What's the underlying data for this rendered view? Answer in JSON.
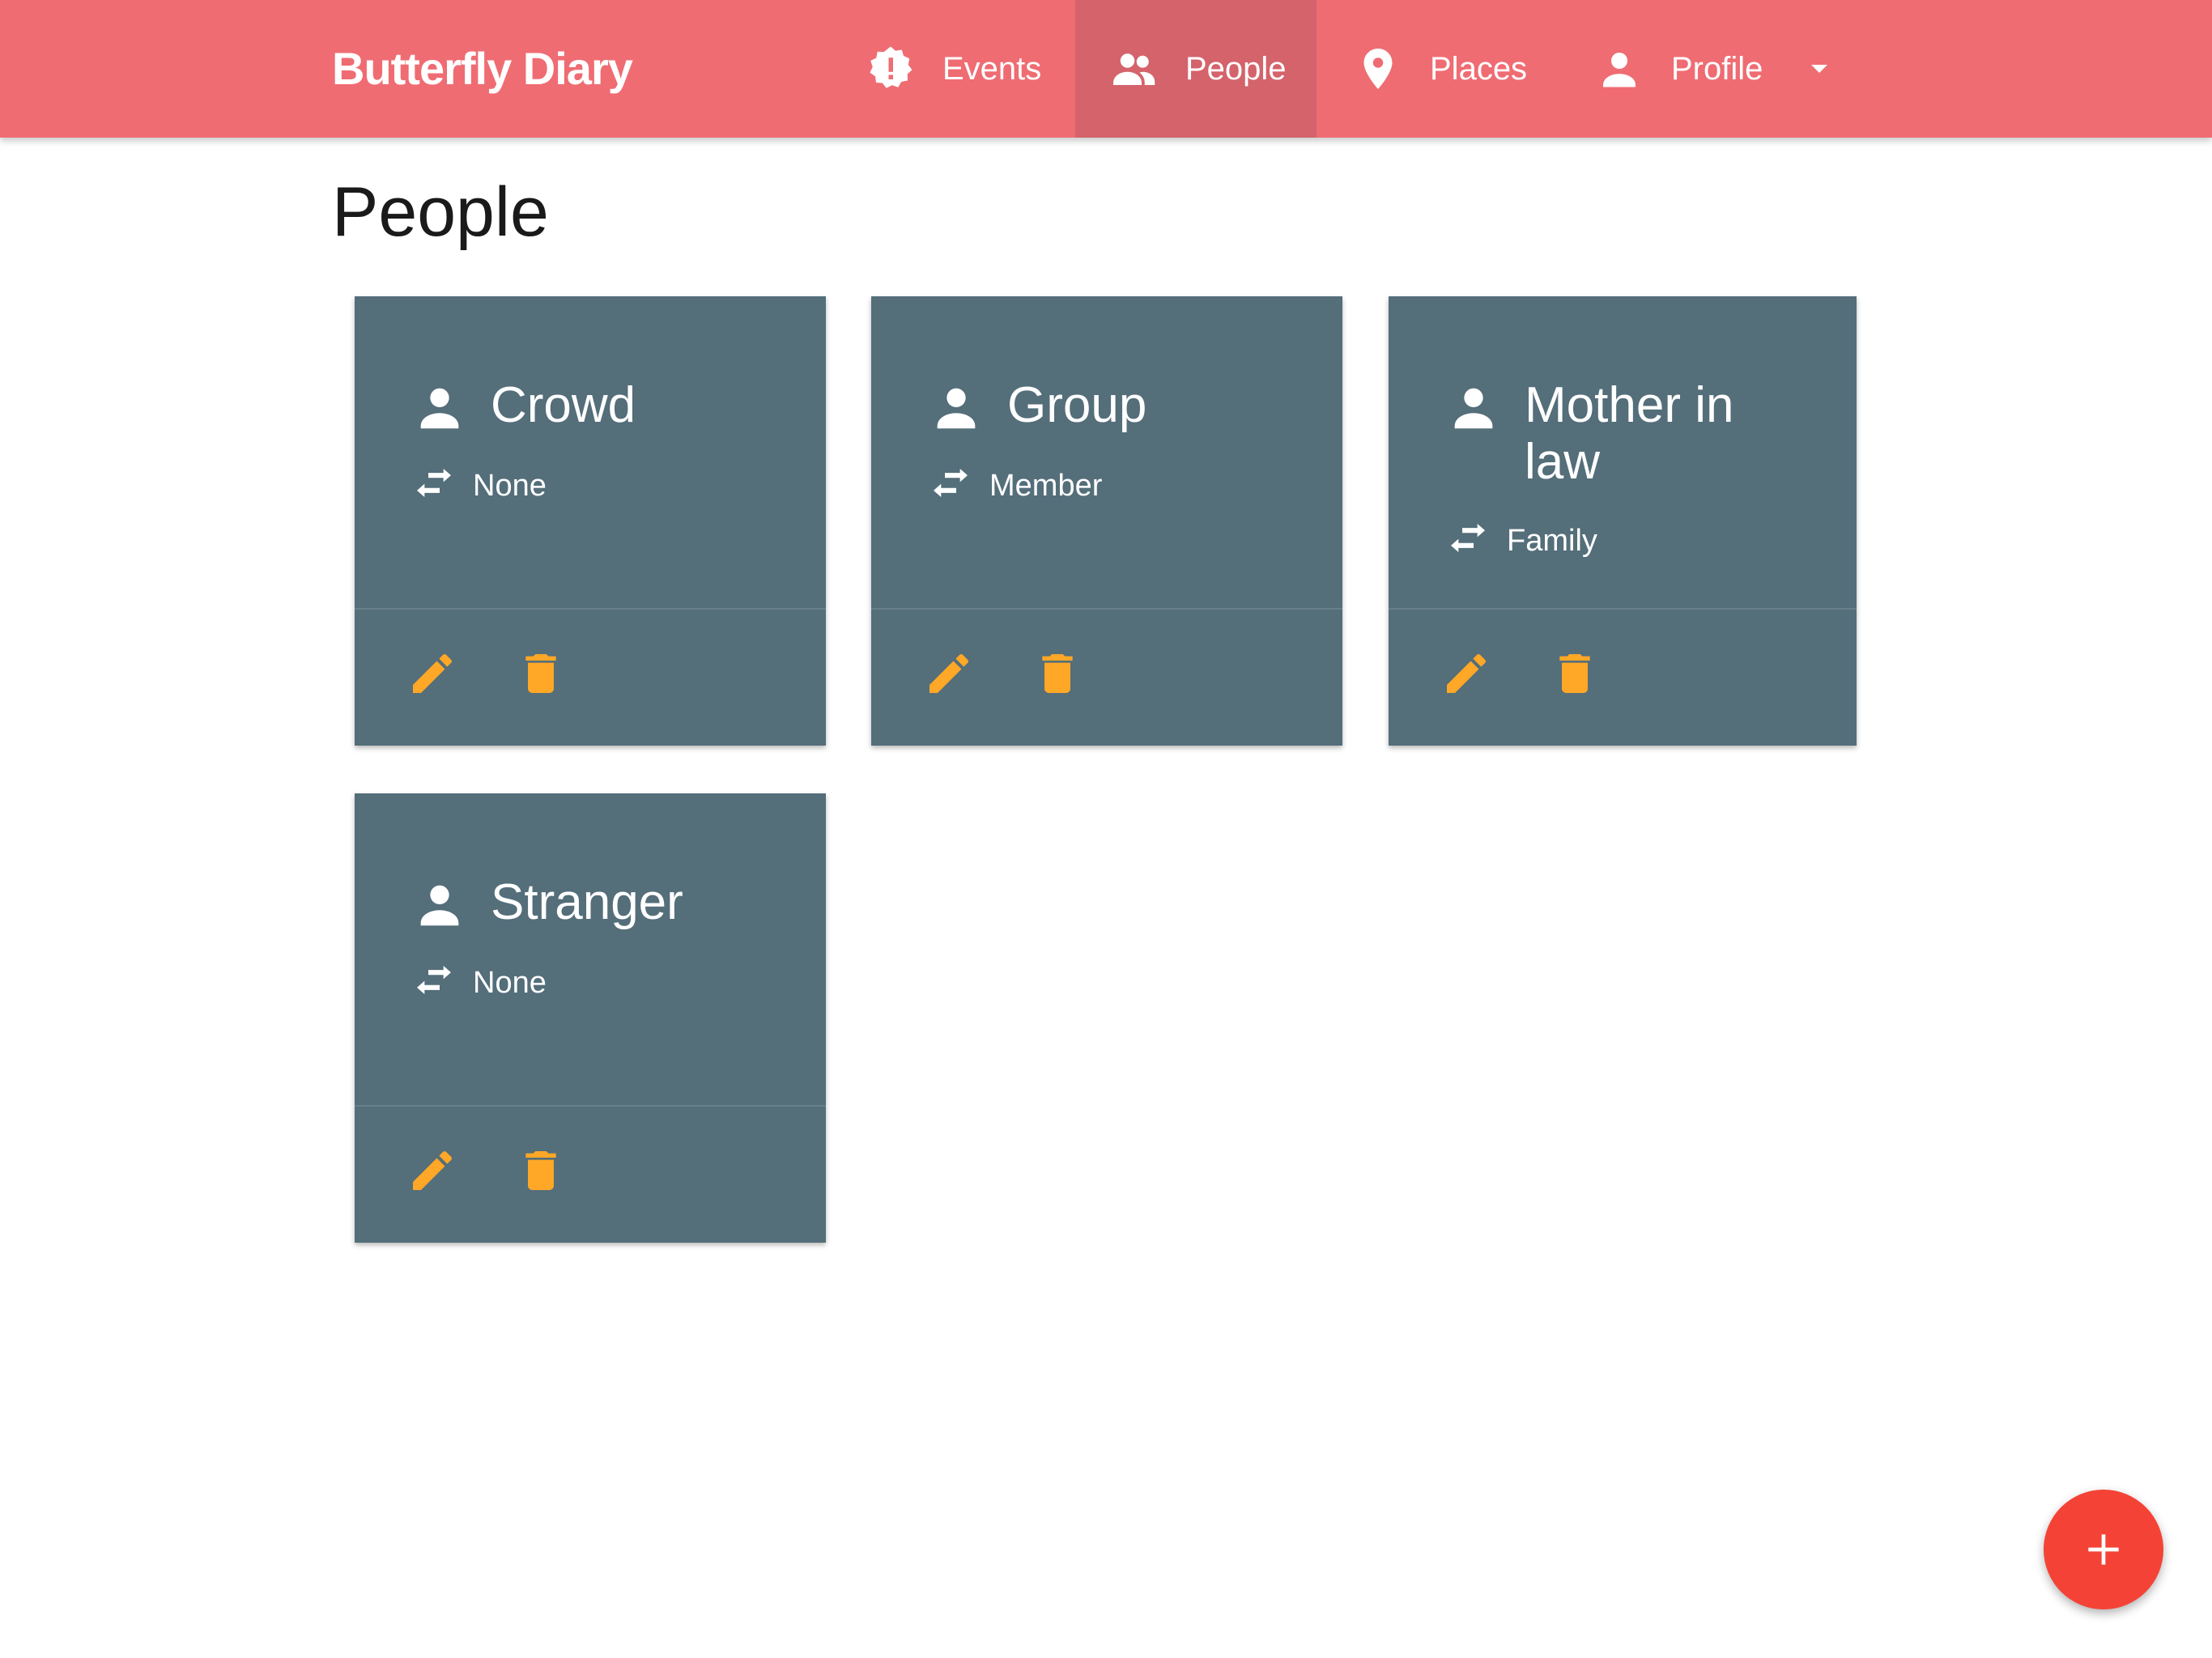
{
  "app": {
    "brand": "Butterfly Diary"
  },
  "nav": {
    "events": {
      "label": "Events",
      "icon": "alert-badge-icon"
    },
    "people": {
      "label": "People",
      "icon": "people-icon",
      "active": true
    },
    "places": {
      "label": "Places",
      "icon": "location-pin-icon"
    },
    "profile": {
      "label": "Profile",
      "icon": "person-icon",
      "dropdown_icon": "caret-down-icon"
    }
  },
  "page": {
    "title": "People"
  },
  "people": [
    {
      "name": "Crowd",
      "relation": "None"
    },
    {
      "name": "Group",
      "relation": "Member"
    },
    {
      "name": "Mother in law",
      "relation": "Family"
    },
    {
      "name": "Stranger",
      "relation": "None"
    }
  ],
  "card_actions": {
    "edit_icon": "pencil-icon",
    "delete_icon": "trash-icon"
  },
  "fab": {
    "icon": "plus-icon"
  },
  "colors": {
    "navbar": "#ef6c73",
    "navbar_active": "#d4636b",
    "card": "#546e7a",
    "action_icon": "#ffa726",
    "fab": "#f44336"
  }
}
